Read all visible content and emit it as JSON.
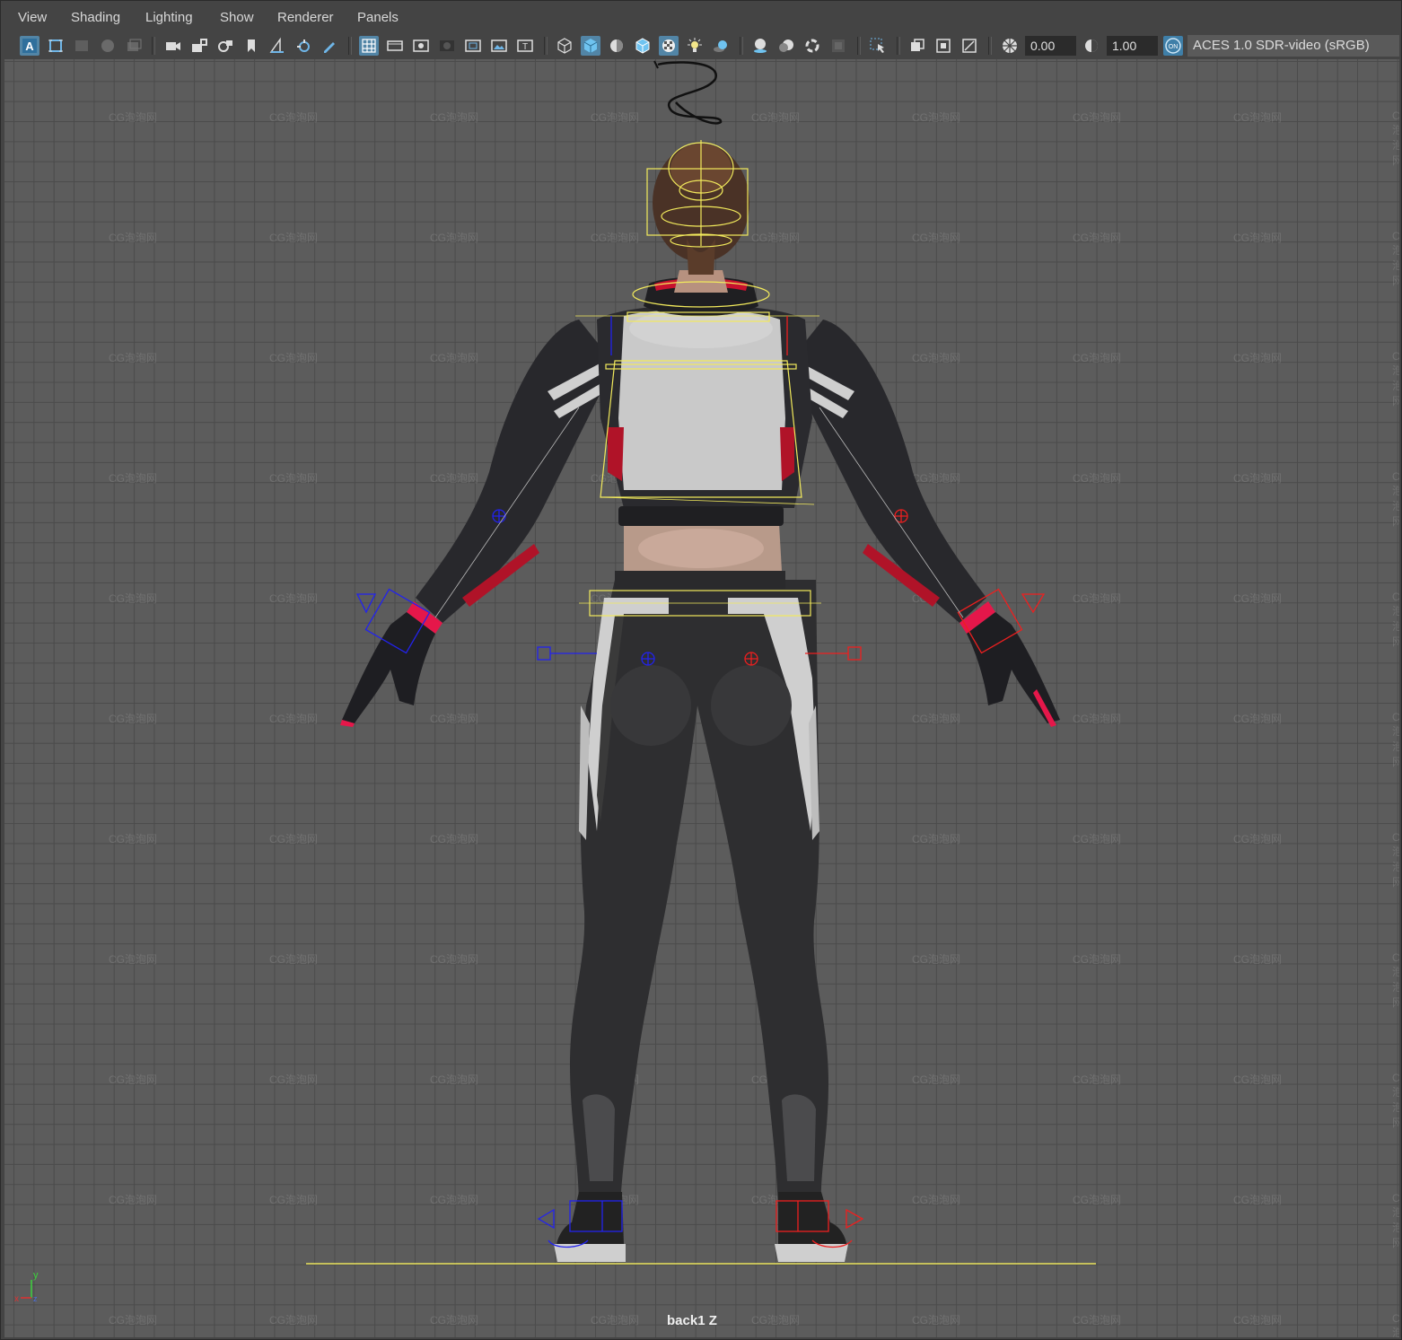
{
  "menubar": {
    "items": [
      "View",
      "Shading",
      "Lighting",
      "Show",
      "Renderer",
      "Panels"
    ]
  },
  "toolbar": {
    "exposure_value": "0.00",
    "gamma_value": "1.00",
    "color_management_badge": "ON",
    "color_space": "ACES 1.0 SDR-video (sRGB)",
    "icons": [
      "select-camera-icon",
      "camera-attributes-icon",
      "bookmarks-icon",
      "image-plane-icon",
      "2d-pan-zoom-icon",
      "grease-pencil-icon",
      "camera-icon",
      "lock-camera-icon",
      "camera-attributes-icon",
      "bookmark-icon",
      "image-plane-icon",
      "2d-pan-icon",
      "grease-pencil-icon",
      "grid-icon",
      "film-gate-icon",
      "resolution-gate-icon",
      "gate-mask-icon",
      "field-chart-icon",
      "safe-action-icon",
      "safe-title-icon",
      "wireframe-icon",
      "smooth-shade-icon",
      "default-material-icon",
      "wireframe-on-shaded-icon",
      "xray-icon",
      "use-all-lights-icon",
      "shadows-icon",
      "ambient-occlusion-icon",
      "motion-blur-icon",
      "anti-aliasing-icon",
      "depth-of-field-icon",
      "isolate-select-icon",
      "xray-joints-icon",
      "xray-active-icon",
      "backface-culling-icon",
      "exposure-icon",
      "gamma-icon",
      "color-management-icon"
    ]
  },
  "viewport": {
    "camera_label": "back1 Z",
    "watermark_text": "CG泡泡网",
    "axis_y_label": "y",
    "axis_x_label": "x",
    "axis_z_label": "z"
  }
}
